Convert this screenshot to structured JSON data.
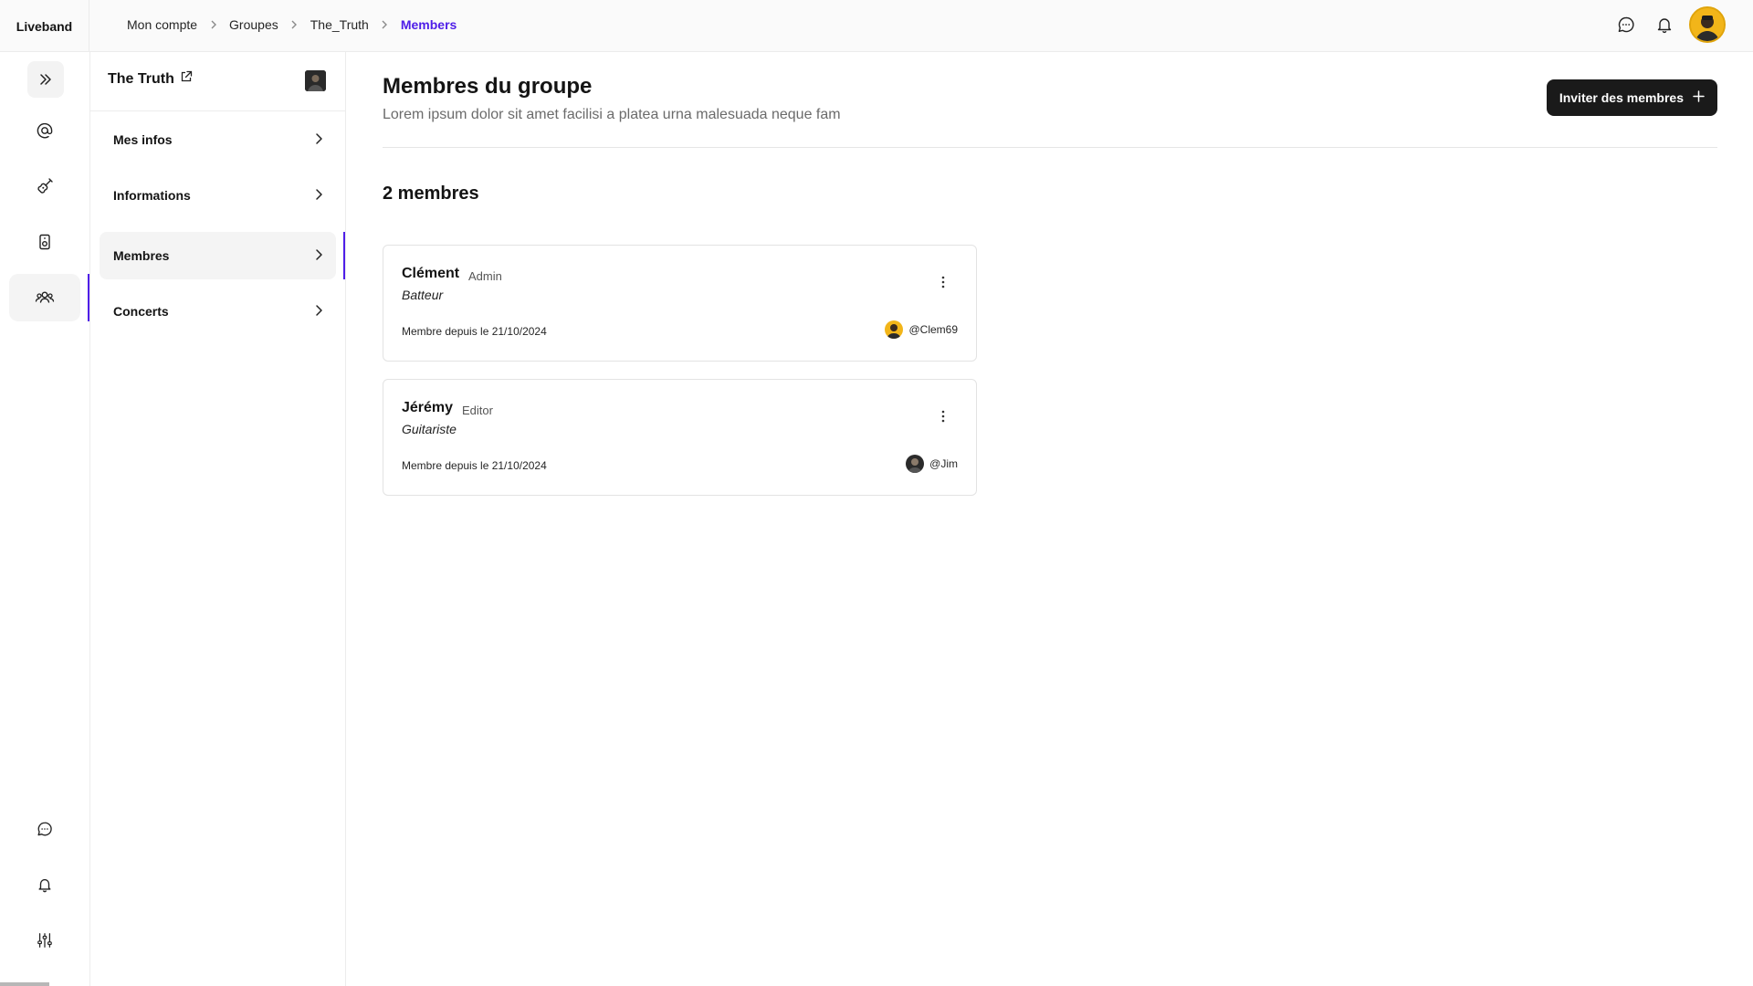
{
  "app": {
    "name": "Liveband"
  },
  "breadcrumb": {
    "items": [
      "Mon compte",
      "Groupes",
      "The_Truth"
    ],
    "current": "Members"
  },
  "topbar_icons": [
    "chat-icon",
    "bell-icon"
  ],
  "rail": {
    "items": [
      "expand-icon",
      "at-icon",
      "guitar-icon",
      "speaker-icon",
      "group-icon"
    ],
    "bottom_items": [
      "chat-icon",
      "bell-icon",
      "sliders-icon",
      "user-icon"
    ]
  },
  "group": {
    "name": "The Truth"
  },
  "secnav": {
    "items": [
      {
        "label": "Mes infos"
      },
      {
        "label": "Informations"
      },
      {
        "label": "Membres"
      },
      {
        "label": "Concerts"
      }
    ]
  },
  "main": {
    "title": "Membres du groupe",
    "subtitle": "Lorem ipsum dolor sit amet facilisi a platea urna malesuada neque fam",
    "invite_label": "Inviter des membres",
    "count_label": "2 membres"
  },
  "members": [
    {
      "name": "Clément",
      "role": "Admin",
      "instrument": "Batteur",
      "since": "Membre depuis le 21/10/2024",
      "handle": "@Clem69"
    },
    {
      "name": "Jérémy",
      "role": "Editor",
      "instrument": "Guitariste",
      "since": "Membre depuis le 21/10/2024",
      "handle": "@Jim"
    }
  ],
  "colors": {
    "accent": "#4f1ee8",
    "primary_button": "#1a1a1a"
  }
}
